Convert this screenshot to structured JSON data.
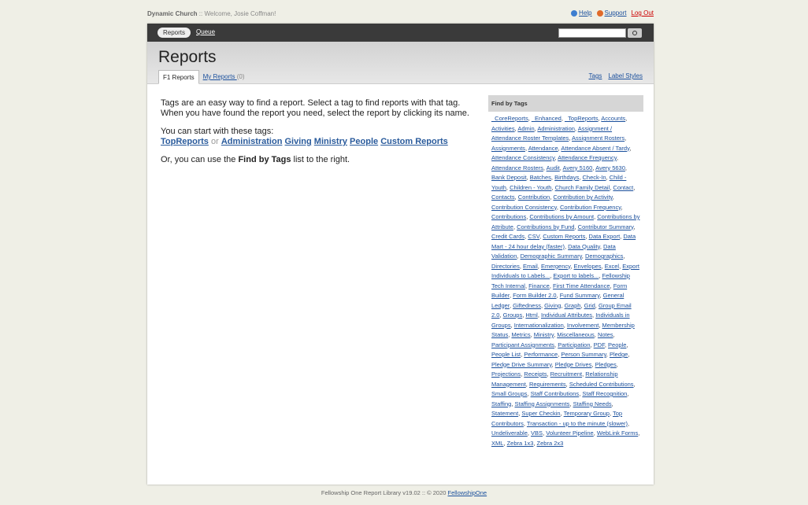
{
  "topbar": {
    "org": "Dynamic Church",
    "sep": " :: ",
    "welcome": "Welcome, Josie Coffman!",
    "help": "Help",
    "support": "Support",
    "logout": "Log Out"
  },
  "nav": {
    "reports": "Reports",
    "queue": "Queue"
  },
  "header": {
    "title": "Reports",
    "tabs": {
      "f1": "F1 Reports",
      "my": "My Reports ",
      "my_count": "(0)"
    },
    "links": {
      "tags": "Tags",
      "label_styles": "Label Styles"
    }
  },
  "main": {
    "intro": "Tags are an easy way to find a report. Select a tag to find reports with that tag. When you have found the report you need, select the report by clicking its name.",
    "start": "You can start with these tags:",
    "tags": [
      "TopReports",
      "Administration",
      "Giving",
      "Ministry",
      "People",
      "Custom Reports"
    ],
    "or_word": "or",
    "right_prefix": "Or, you can use the ",
    "right_bold": "Find by Tags",
    "right_suffix": " list to the right."
  },
  "side": {
    "title": "Find by Tags",
    "tags": [
      "_CoreReports",
      "_Enhanced",
      "_TopReports",
      "Accounts",
      "Activities",
      "Admin",
      "Administration",
      "Assignment / Attendance Roster Templates",
      "Assignment Rosters",
      "Assignments",
      "Attendance",
      "Attendance Absent / Tardy",
      "Attendance Consistency",
      "Attendance Frequency",
      "Attendance Rosters",
      "Audit",
      "Avery 5160",
      "Avery 5630",
      "Bank Deposit",
      "Batches",
      "Birthdays",
      "Check-In",
      "Child - Youth",
      "Children - Youth",
      "Church Family Detail",
      "Contact",
      "Contacts",
      "Contribution",
      "Contribution by Activity",
      "Contribution Consistency",
      "Contribution Frequency",
      "Contributions",
      "Contributions by Amount",
      "Contributions by Attribute",
      "Contributions by Fund",
      "Contributor Summary",
      "Credit Cards",
      "CSV",
      "Custom Reports",
      "Data Export",
      "Data Mart - 24 hour delay (faster)",
      "Data Quality",
      "Data Validation",
      "Demographic Summary",
      "Demographics",
      "Directories",
      "Email",
      "Emergency",
      "Envelopes",
      "Excel",
      "Export Individuals to Labels...",
      "Export to labels...",
      "Fellowship Tech Internal",
      "Finance",
      "First Time Attendance",
      "Form Builder",
      "Form Builder 2.0",
      "Fund Summary",
      "General Ledger",
      "Giftedness",
      "Giving",
      "Graph",
      "Grid",
      "Group Email 2.0",
      "Groups",
      "Html",
      "Individual Attributes",
      "Individuals in Groups",
      "Internationalization",
      "Involvement",
      "Membership Status",
      "Metrics",
      "Ministry",
      "Miscellaneous",
      "Notes",
      "Participant Assignments",
      "Participation",
      "PDF",
      "People",
      "People List",
      "Performance",
      "Person Summary",
      "Pledge",
      "Pledge Drive Summary",
      "Pledge Drives",
      "Pledges",
      "Projections",
      "Receipts",
      "Recruitment",
      "Relationship Management",
      "Requirements",
      "Scheduled Contributions",
      "Small Groups",
      "Staff Contributions",
      "Staff Recognition",
      "Staffing",
      "Staffing Assignments",
      "Staffing Needs",
      "Statement",
      "Super Checkin",
      "Temporary Group",
      "Top Contributors",
      "Transaction - up to the minute (slower)",
      "Undeliverable",
      "VBS",
      "Volunteer Pipeline",
      "WebLink Forms",
      "XML",
      "Zebra 1x3",
      "Zebra 2x3"
    ]
  },
  "footer": {
    "prefix": "Fellowship One Report Library v19.02 :: © 2020 ",
    "link": "FellowshipOne"
  }
}
